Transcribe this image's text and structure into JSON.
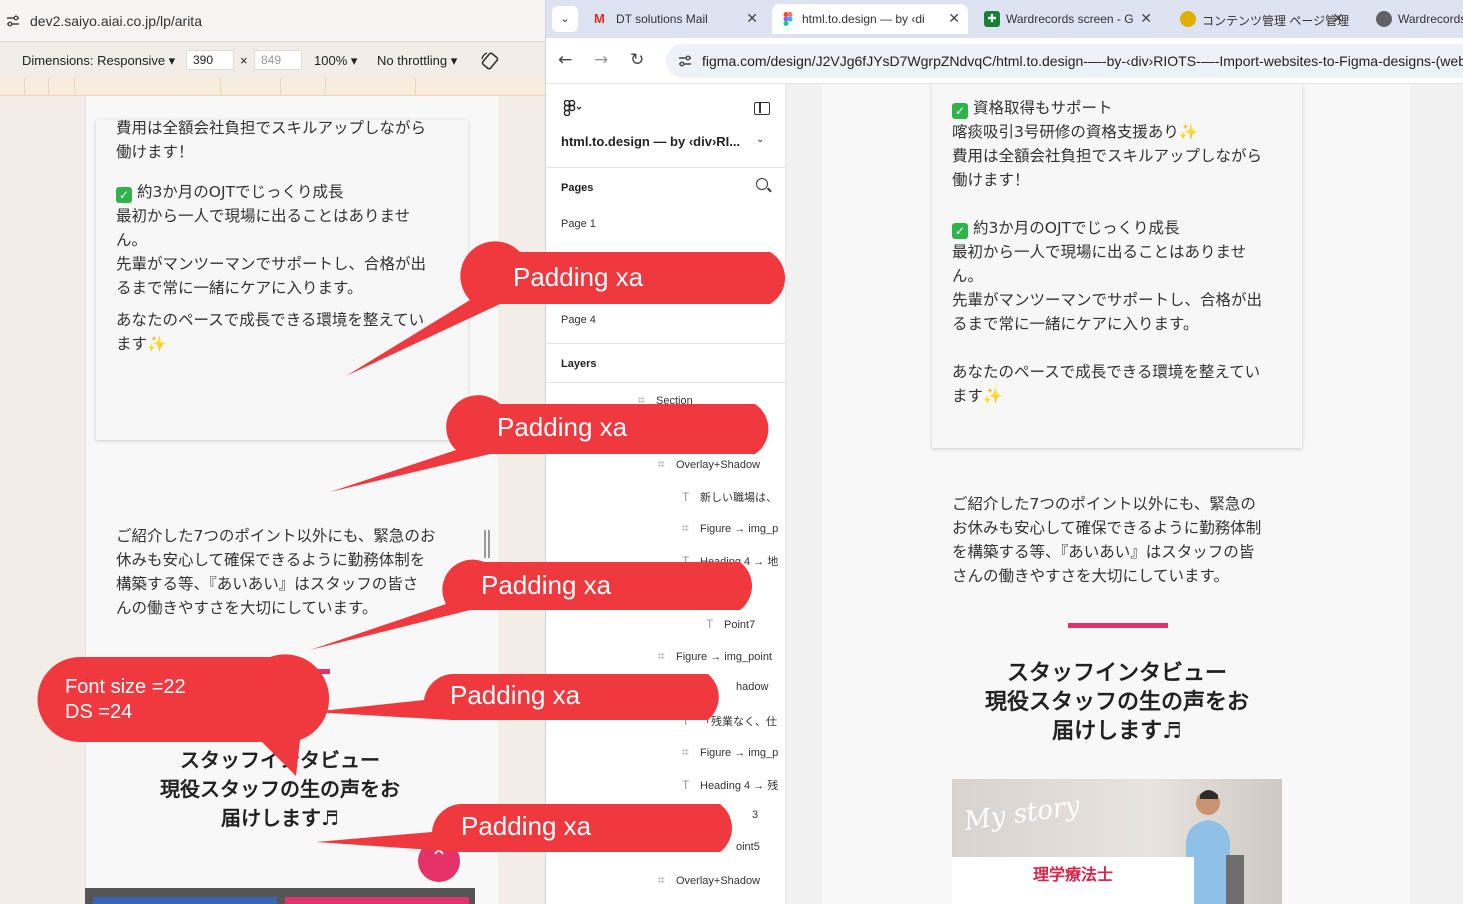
{
  "left": {
    "url": "dev2.saiyo.aiai.co.jp/lp/arita",
    "toolbar": {
      "dimensions": "Dimensions: Responsive ▾",
      "width": "390",
      "times": "×",
      "height": "849",
      "zoom": "100% ▾",
      "throttling": "No throttling ▾"
    },
    "card_lines": [
      "費用は全額会社負担でスキルアップしながら",
      "働けます！",
      "約3か月のOJTでじっくり成長",
      "最初から一人で現場に出ることはありませ",
      "ん。",
      "先輩がマンツーマンでサポートし、合格が出",
      "るまで常に一緒にケアに入ります。",
      "あなたのペースで成長できる環境を整えてい",
      "ます"
    ],
    "intro_lines": [
      "ご紹介した7つのポイント以外にも、緊急のお",
      "休みも安心して確保できるように勤務体制を",
      "構築する等、『あいあい』はスタッフの皆さ",
      "んの働きやすさを大切にしています。"
    ],
    "heading_lines": [
      "スタッフインタビュー",
      "現役スタッフの生の声をお",
      "届けします♬"
    ],
    "scroll_top": "⌃"
  },
  "tabs": [
    {
      "label": "DT solutions Mail",
      "icon_color": "#d93025"
    },
    {
      "label": "html.to.design — by ‹di",
      "icon_color": "#a259ff"
    },
    {
      "label": "Wardrecords screen - G",
      "icon_color": "#188038"
    },
    {
      "label": "コンテンツ管理 ページ管理",
      "icon_color": "#e0b000"
    },
    {
      "label": "Wardrecords",
      "icon_color": "#5f6368"
    }
  ],
  "address": {
    "url": "figma.com/design/J2VJg6fJYsD7WgrpZNdvqC/html.to.design-—-by-‹div›RIOTS-—-Import-websites-to-Figma-designs-(web"
  },
  "figma": {
    "file_name": "html.to.design — by ‹div›RI...",
    "pages_label": "Pages",
    "pages": [
      "Page 1",
      "Page 4"
    ],
    "layers_label": "Layers",
    "layers": [
      {
        "glyph": "⌗",
        "name": "Section"
      },
      {
        "glyph": "⌗",
        "name": "Overlay+Shadow"
      },
      {
        "glyph": "T",
        "name": "新しい職場は、"
      },
      {
        "glyph": "⌗",
        "name": "Figure → img_p"
      },
      {
        "glyph": "T",
        "name": "Heading 4 → 地"
      },
      {
        "glyph": "T",
        "name": "Point7"
      },
      {
        "glyph": "⌗",
        "name": "Figure → img_point"
      },
      {
        "glyph": "",
        "name": "hadow"
      },
      {
        "glyph": "T",
        "name": "「残業なく、仕"
      },
      {
        "glyph": "⌗",
        "name": "Figure → img_p"
      },
      {
        "glyph": "T",
        "name": "Heading 4 → 残"
      },
      {
        "glyph": "",
        "name": "3"
      },
      {
        "glyph": "",
        "name": "oint5"
      },
      {
        "glyph": "⌗",
        "name": "Overlay+Shadow"
      }
    ]
  },
  "canvas": {
    "card_lines": [
      "資格取得もサポート",
      "喀痰吸引3号研修の資格支援あり",
      " 費用は全額会社負担でスキルアップしながら",
      "働けます！",
      "",
      "約3か月のOJTでじっくり成長",
      "最初から一人で現場に出ることはありませ",
      "ん。",
      "先輩がマンツーマンでサポートし、合格が出",
      "るまで常に一緒にケアに入ります。",
      "",
      "あなたのペースで成長できる環境を整えてい",
      "ます"
    ],
    "intro_lines": [
      "ご紹介した7つのポイント以外にも、緊急の",
      "お休みも安心して確保できるように勤務体制",
      "を構築する等、『あいあい』はスタッフの皆",
      "さんの働きやすさを大切にしています。"
    ],
    "heading_lines": [
      "スタッフインタビュー",
      "現役スタッフの生の声をお",
      "届けします♬"
    ],
    "photo_script": "My story",
    "photo_role": "理学療法士"
  },
  "annotations": {
    "callouts": [
      "Padding xa",
      "Padding xa",
      "Padding xa",
      "Padding xa",
      "Padding xa"
    ],
    "font_note": [
      "Font size =22",
      "DS =24"
    ]
  },
  "colors": {
    "callout": "#f0393f",
    "accent_pink": "#e0336d",
    "check_green": "#2fb34a"
  }
}
